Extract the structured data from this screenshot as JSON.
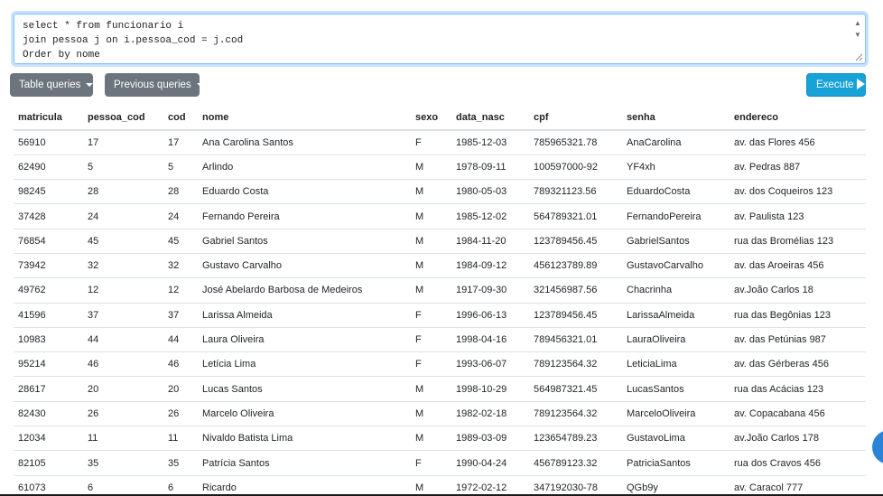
{
  "query": {
    "text": "select * from funcionario i\njoin pessoa j on i.pessoa_cod = j.cod\nOrder by nome"
  },
  "toolbar": {
    "table_queries_label": "Table queries",
    "previous_queries_label": "Previous queries",
    "execute_label": "Execute"
  },
  "colors": {
    "gray_button": "#6c757d",
    "execute_button": "#17a2d8",
    "focus_border": "#80bdff"
  },
  "results": {
    "columns": [
      "matricula",
      "pessoa_cod",
      "cod",
      "nome",
      "sexo",
      "data_nasc",
      "cpf",
      "senha",
      "endereco"
    ],
    "rows": [
      [
        "56910",
        "17",
        "17",
        "Ana Carolina Santos",
        "F",
        "1985-12-03",
        "785965321.78",
        "AnaCarolina",
        "av. das Flores 456"
      ],
      [
        "62490",
        "5",
        "5",
        "Arlindo",
        "M",
        "1978-09-11",
        "100597000-92",
        "YF4xh",
        "av. Pedras 887"
      ],
      [
        "98245",
        "28",
        "28",
        "Eduardo Costa",
        "M",
        "1980-05-03",
        "789321123.56",
        "EduardoCosta",
        "av. dos Coqueiros 123"
      ],
      [
        "37428",
        "24",
        "24",
        "Fernando Pereira",
        "M",
        "1985-12-02",
        "564789321.01",
        "FernandoPereira",
        "av. Paulista 123"
      ],
      [
        "76854",
        "45",
        "45",
        "Gabriel Santos",
        "M",
        "1984-11-20",
        "123789456.45",
        "GabrielSantos",
        "rua das Bromélias 123"
      ],
      [
        "73942",
        "32",
        "32",
        "Gustavo Carvalho",
        "M",
        "1984-09-12",
        "456123789.89",
        "GustavoCarvalho",
        "av. das Aroeiras 456"
      ],
      [
        "49762",
        "12",
        "12",
        "José Abelardo Barbosa de Medeiros",
        "M",
        "1917-09-30",
        "321456987.56",
        "Chacrinha",
        "av.João Carlos 18"
      ],
      [
        "41596",
        "37",
        "37",
        "Larissa Almeida",
        "F",
        "1996-06-13",
        "123789456.45",
        "LarissaAlmeida",
        "rua das Begônias 123"
      ],
      [
        "10983",
        "44",
        "44",
        "Laura Oliveira",
        "F",
        "1998-04-16",
        "789456321.01",
        "LauraOliveira",
        "av. das Petúnias 987"
      ],
      [
        "95214",
        "46",
        "46",
        "Letícia Lima",
        "F",
        "1993-06-07",
        "789123564.32",
        "LeticiaLima",
        "av. das Gérberas 456"
      ],
      [
        "28617",
        "20",
        "20",
        "Lucas Santos",
        "M",
        "1998-10-29",
        "564987321.45",
        "LucasSantos",
        "rua das Acácias 123"
      ],
      [
        "82430",
        "26",
        "26",
        "Marcelo Oliveira",
        "M",
        "1982-02-18",
        "789123564.32",
        "MarceloOliveira",
        "av. Copacabana 456"
      ],
      [
        "12034",
        "11",
        "11",
        "Nivaldo Batista Lima",
        "M",
        "1989-03-09",
        "123654789.23",
        "GustavoLima",
        "av.João Carlos 178"
      ],
      [
        "82105",
        "35",
        "35",
        "Patrícia Santos",
        "F",
        "1990-04-24",
        "456789123.32",
        "PatriciaSantos",
        "rua dos Cravos 456"
      ],
      [
        "61073",
        "6",
        "6",
        "Ricardo",
        "M",
        "1972-02-12",
        "347192030-78",
        "QGb9y",
        "av. Caracol 777"
      ]
    ]
  }
}
